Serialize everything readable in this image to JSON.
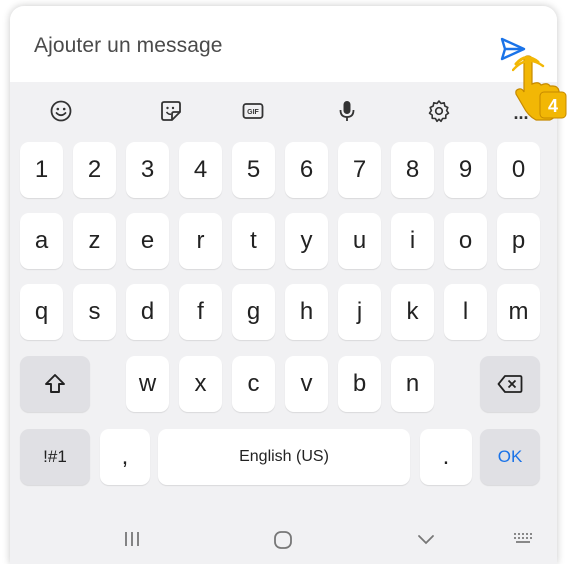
{
  "message_bar": {
    "placeholder": "Ajouter un message",
    "send_icon": "send-icon"
  },
  "toolbar": {
    "icons": [
      "emoji-icon",
      "sticker-icon",
      "gif-icon",
      "microphone-icon",
      "settings-icon",
      "more-icon"
    ],
    "gif_label": "GIF",
    "more_label": "..."
  },
  "keyboard": {
    "row_numbers": [
      "1",
      "2",
      "3",
      "4",
      "5",
      "6",
      "7",
      "8",
      "9",
      "0"
    ],
    "row_1": [
      "a",
      "z",
      "e",
      "r",
      "t",
      "y",
      "u",
      "i",
      "o",
      "p"
    ],
    "row_2": [
      "q",
      "s",
      "d",
      "f",
      "g",
      "h",
      "j",
      "k",
      "l",
      "m"
    ],
    "row_3": [
      "w",
      "x",
      "c",
      "v",
      "b",
      "n"
    ],
    "symbols_label": "!#1",
    "comma_label": ",",
    "space_label": "English (US)",
    "period_label": ".",
    "ok_label": "OK",
    "shift_icon": "shift-icon",
    "backspace_icon": "backspace-icon"
  },
  "nav": {
    "icons": [
      "recent-apps-icon",
      "home-icon",
      "hide-keyboard-icon",
      "keyboard-switch-icon"
    ]
  },
  "annotation": {
    "step_number": "4",
    "badge_color": "#f2b705",
    "hand_icon": "pointing-hand-icon"
  },
  "colors": {
    "accent": "#1a73e8",
    "key_background": "#ffffff",
    "special_key_background": "#e0e0e4",
    "keyboard_background": "#f1f1f3"
  }
}
